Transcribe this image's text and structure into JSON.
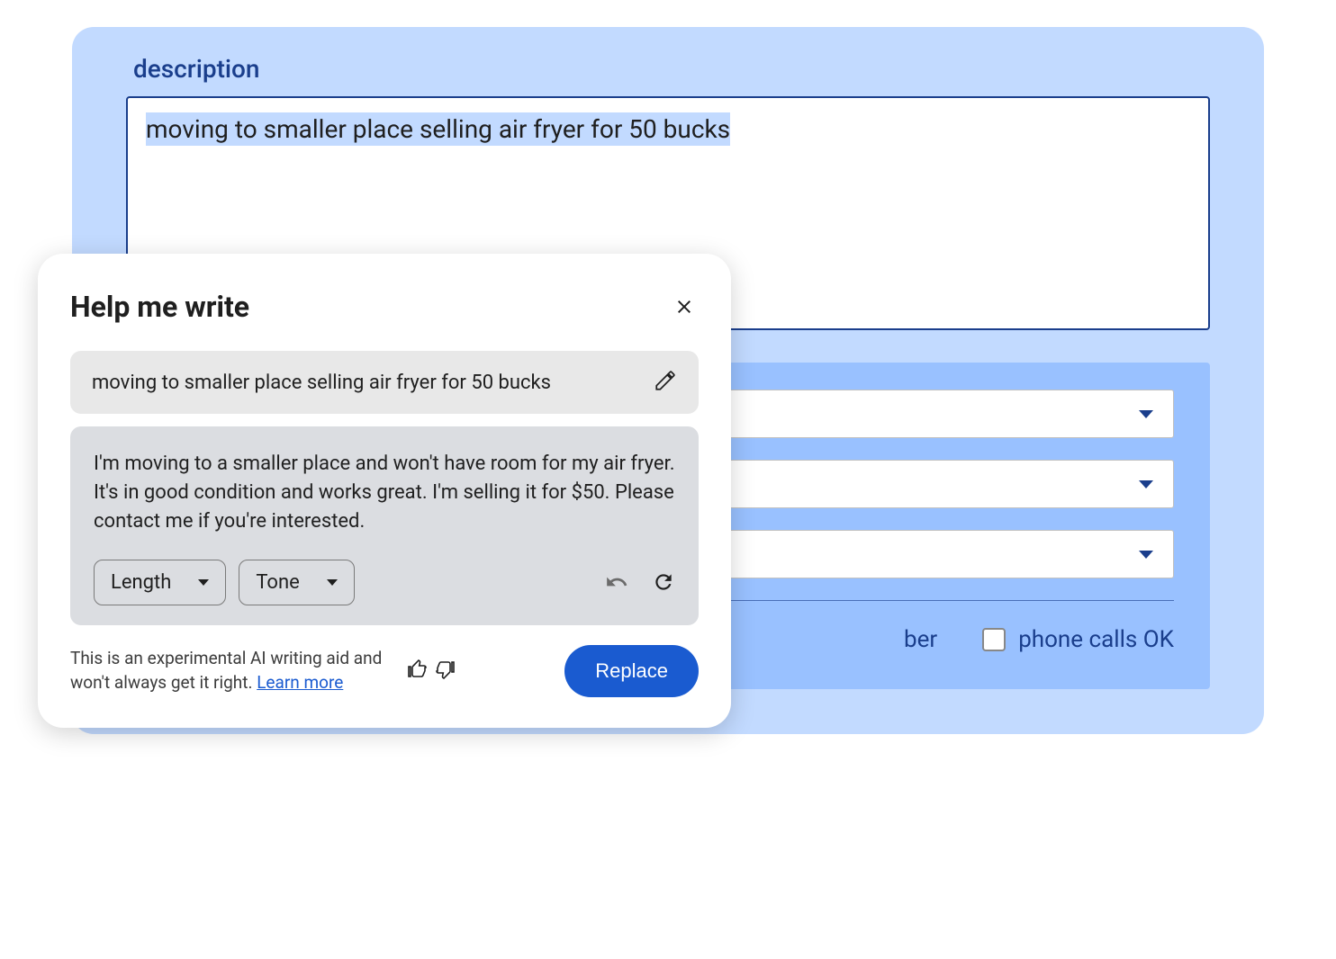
{
  "form": {
    "label": "description",
    "description_text": "moving to smaller place selling air fryer for 50 bucks",
    "number_suffix": "ber",
    "checkbox_label": "phone calls OK"
  },
  "modal": {
    "title": "Help me write",
    "prompt": "moving to smaller place selling air fryer for 50 bucks",
    "suggestion": "I'm moving to a smaller place and won't have room for my air fryer. It's in good condition and works great. I'm selling it for $50. Please contact me if you're interested.",
    "length_label": "Length",
    "tone_label": "Tone",
    "disclaimer": "This is an experimental AI writing aid and won't always get it right. ",
    "learn_more": "Learn more",
    "replace_label": "Replace"
  }
}
